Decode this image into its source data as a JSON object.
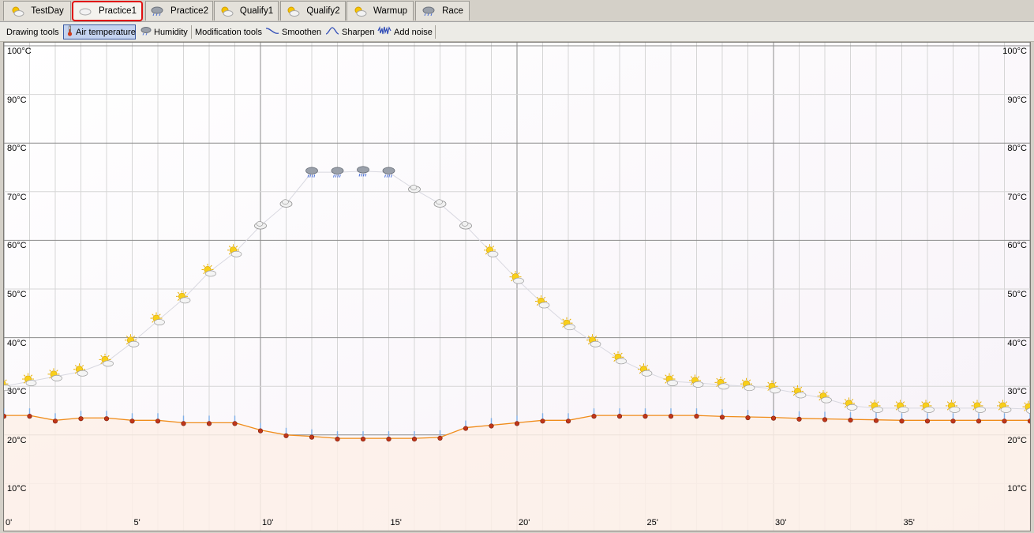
{
  "tabs": [
    {
      "label": "TestDay",
      "icon": "sun-cloud-icon",
      "active": false
    },
    {
      "label": "Practice1",
      "icon": "cloud-icon",
      "active": true
    },
    {
      "label": "Practice2",
      "icon": "rain-cloud-icon",
      "active": false
    },
    {
      "label": "Qualify1",
      "icon": "sun-cloud-icon",
      "active": false
    },
    {
      "label": "Qualify2",
      "icon": "sun-cloud-icon",
      "active": false
    },
    {
      "label": "Warmup",
      "icon": "sun-cloud-icon",
      "active": false
    },
    {
      "label": "Race",
      "icon": "rain-cloud-icon",
      "active": false
    }
  ],
  "toolbar": {
    "drawing_tools": "Drawing tools",
    "air_temperature": "Air temperature",
    "humidity": "Humidity",
    "modification_tools": "Modification tools",
    "smoothen": "Smoothen",
    "sharpen": "Sharpen",
    "add_noise": "Add noise",
    "selected": "Air temperature"
  },
  "colors": {
    "temperature_line": "#f08c1a",
    "temperature_fill": "#fdf0e8",
    "humidity_line": "#d8d8e0",
    "grid_major": "#8c8c8c",
    "grid_minor": "#d6d6d6",
    "selected_tool_bg": "#c4d3ef",
    "active_tab_outline": "#e01010"
  },
  "chart_data": {
    "type": "line",
    "xlabel": "",
    "ylabel": "",
    "x_tick_labels": [
      "0'",
      "5'",
      "10'",
      "15'",
      "20'",
      "25'",
      "30'",
      "35'"
    ],
    "y_tick_labels": [
      "10°C",
      "20°C",
      "30°C",
      "40°C",
      "50°C",
      "60°C",
      "70°C",
      "80°C",
      "90°C",
      "100°C"
    ],
    "xlim": [
      0,
      40
    ],
    "ylim": [
      0,
      100
    ],
    "grid": true,
    "x": [
      0,
      1,
      2,
      3,
      4,
      5,
      6,
      7,
      8,
      9,
      10,
      11,
      12,
      13,
      14,
      15,
      16,
      17,
      18,
      19,
      20,
      21,
      22,
      23,
      24,
      25,
      26,
      27,
      28,
      29,
      30,
      31,
      32,
      33,
      34,
      35,
      36,
      37,
      38,
      39,
      40
    ],
    "series": [
      {
        "values": [
          24,
          24,
          23,
          23.5,
          23.5,
          23,
          23,
          22.5,
          22.5,
          22.5,
          21,
          20,
          19.7,
          19.3,
          19.3,
          19.3,
          19.3,
          19.5,
          21.5,
          22,
          22.5,
          23,
          23,
          24,
          24,
          24,
          24,
          24,
          23.8,
          23.7,
          23.6,
          23.4,
          23.3,
          23.2,
          23.1,
          23,
          23,
          23,
          23,
          23,
          23
        ],
        "color": "temperature_line",
        "filled": true
      },
      {
        "values": [
          30,
          31,
          32,
          33,
          35,
          39,
          43.5,
          48,
          53.5,
          57.5,
          63,
          67.5,
          74,
          74,
          74.2,
          74,
          70.5,
          67.5,
          63,
          57.5,
          52,
          47,
          42.5,
          39,
          35.5,
          33,
          31,
          30.7,
          30.3,
          30,
          29.5,
          28.5,
          27.5,
          26,
          25.5,
          25.5,
          25.5,
          25.5,
          25.5,
          25.5,
          25.3
        ],
        "color": "humidity_line",
        "filled": false,
        "weather": [
          "sun-cloud",
          "sun-cloud",
          "sun-cloud",
          "sun-cloud",
          "sun-cloud",
          "sun-cloud",
          "sun-cloud",
          "sun-cloud",
          "sun-cloud",
          "sun-cloud",
          "cloud",
          "cloud",
          "rain-cloud",
          "rain-cloud",
          "rain-cloud",
          "rain-cloud",
          "cloud",
          "cloud",
          "cloud",
          "sun-cloud",
          "sun-cloud",
          "sun-cloud",
          "sun-cloud",
          "sun-cloud",
          "sun-cloud",
          "sun-cloud",
          "sun-cloud",
          "sun-cloud",
          "sun-cloud",
          "sun-cloud",
          "sun-cloud",
          "sun-cloud",
          "sun-cloud",
          "sun-cloud",
          "sun-cloud",
          "sun-cloud",
          "sun-cloud",
          "sun-cloud",
          "sun-cloud",
          "sun-cloud",
          "sun-cloud"
        ]
      }
    ]
  }
}
